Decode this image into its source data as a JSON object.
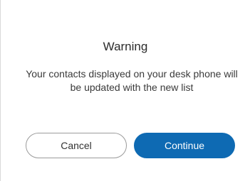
{
  "dialog": {
    "title": "Warning",
    "message": "Your contacts displayed on your desk phone will be updated with the new list",
    "buttons": {
      "cancel_label": "Cancel",
      "continue_label": "Continue"
    }
  },
  "colors": {
    "primary": "#0e6ab3",
    "border": "#9b9b9b",
    "text": "#3a3a3a"
  }
}
